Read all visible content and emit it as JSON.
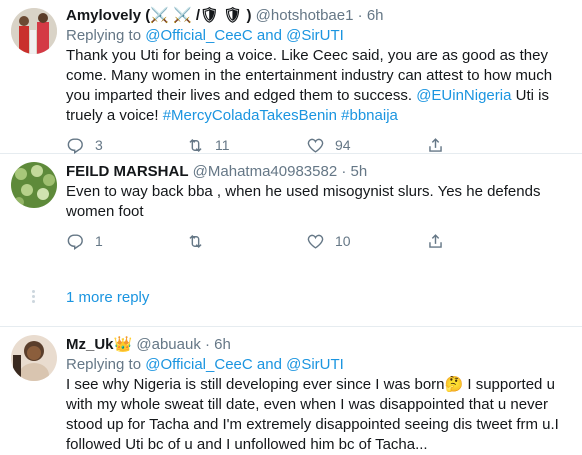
{
  "tweets": [
    {
      "name": "Amylovely (⚔️ ⚔️ /🛡 🛡 )",
      "handle": "@hotshotbae1",
      "dot": "·",
      "time": "6h",
      "replying_prefix": "Replying to ",
      "reply_user1": "@Official_CeeC",
      "reply_and": " and ",
      "reply_user2": "@SirUTI",
      "text_part1": "Thank you Uti for being a voice. Like Ceec said, you are as good as they come. Many women in the entertainment industry can attest to how much you imparted their lives and edged them to success. ",
      "mention": "@EUinNigeria",
      "text_part2": " Uti is truely a voice! ",
      "hashtags": "#MercyColadaTakesBenin #bbnaija",
      "replies": "3",
      "retweets": "11",
      "likes": "94"
    },
    {
      "name": "FEILD MARSHAL",
      "handle": "@Mahatma40983582",
      "dot": "·",
      "time": "5h",
      "text": "Even to way back bba , when he used misogynist slurs.  Yes he defends women foot",
      "replies": "1",
      "retweets": "",
      "likes": "10"
    },
    {
      "name": "Mz_Uk👑",
      "handle": "@abuauk",
      "dot": "·",
      "time": "6h",
      "replying_prefix": "Replying to ",
      "reply_user1": "@Official_CeeC",
      "reply_and": " and ",
      "reply_user2": "@SirUTI",
      "text": "I see why Nigeria is still developing ever since I was born🤔 I supported u with my whole sweat till date, even when I was disappointed that u never stood up for Tacha and I'm extremely disappointed seeing dis tweet frm u.I followed Uti bc of u and I unfollowed him bc of Tacha..."
    }
  ],
  "more_replies": "1 more reply",
  "icons": {
    "reply": "reply-icon",
    "retweet": "retweet-icon",
    "like": "heart-icon",
    "share": "share-icon"
  },
  "colors": {
    "link": "#1b95e0",
    "muted": "#657786",
    "divider": "#e6ecf0"
  }
}
